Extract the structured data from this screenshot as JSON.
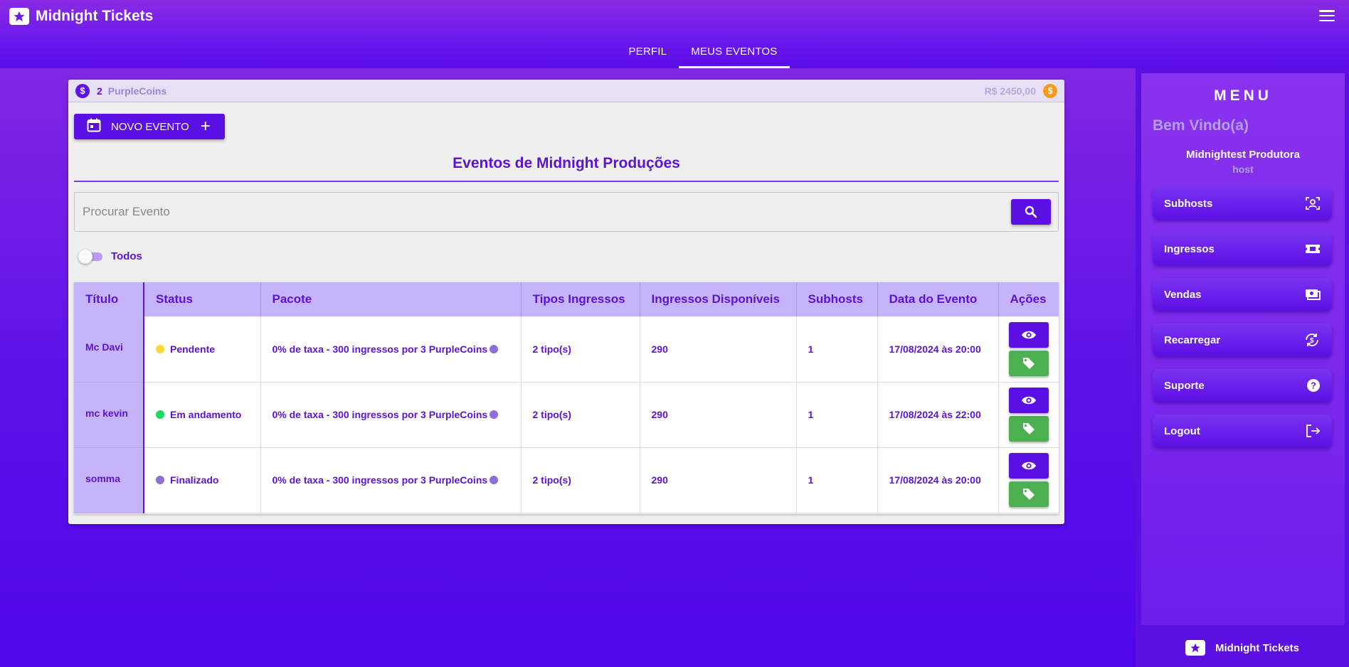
{
  "app": {
    "title": "Midnight Tickets"
  },
  "tabs": [
    {
      "label": "PERFIL",
      "active": false
    },
    {
      "label": "MEUS EVENTOS",
      "active": true
    }
  ],
  "coins": {
    "count": "2",
    "label": "PurpleCoins",
    "balance": "R$ 2450,00"
  },
  "toolbar": {
    "new_event_label": "NOVO EVENTO"
  },
  "page": {
    "title": "Eventos de Midnight Produções"
  },
  "search": {
    "placeholder": "Procurar Evento",
    "value": ""
  },
  "filter": {
    "toggle_label": "Todos",
    "toggle_on": false
  },
  "table": {
    "headers": [
      "Título",
      "Status",
      "Pacote",
      "Tipos Ingressos",
      "Ingressos Disponíveis",
      "Subhosts",
      "Data do Evento",
      "Ações"
    ],
    "rows": [
      {
        "title": "Mc Davi",
        "status": "Pendente",
        "status_color": "#fdd835",
        "package": "0% de taxa - 300 ingressos por 3 PurpleCoins",
        "ticket_types": "2 tipo(s)",
        "available": "290",
        "subhosts": "1",
        "date": "17/08/2024 às 20:00"
      },
      {
        "title": "mc kevin",
        "status": "Em andamento",
        "status_color": "#1ed760",
        "package": "0% de taxa - 300 ingressos por 3 PurpleCoins",
        "ticket_types": "2 tipo(s)",
        "available": "290",
        "subhosts": "1",
        "date": "17/08/2024 às 22:00"
      },
      {
        "title": "somma",
        "status": "Finalizado",
        "status_color": "#8e6fd8",
        "package": "0% de taxa - 300 ingressos por 3 PurpleCoins",
        "ticket_types": "2 tipo(s)",
        "available": "290",
        "subhosts": "1",
        "date": "17/08/2024 às 20:00"
      }
    ]
  },
  "sidebar": {
    "menu_title": "MENU",
    "welcome": "Bem Vindo(a)",
    "user_name": "Midnightest Produtora",
    "user_role": "host",
    "items": [
      {
        "label": "Subhosts",
        "icon": "user-scan-icon"
      },
      {
        "label": "Ingressos",
        "icon": "ticket-icon"
      },
      {
        "label": "Vendas",
        "icon": "money-icon"
      },
      {
        "label": "Recarregar",
        "icon": "reload-dollar-icon"
      },
      {
        "label": "Suporte",
        "icon": "help-icon"
      },
      {
        "label": "Logout",
        "icon": "logout-icon"
      }
    ],
    "footer_title": "Midnight Tickets"
  },
  "colors": {
    "primary": "#5c0fe3",
    "accent_purple": "#c6b4fb",
    "success": "#4caf50",
    "coin_orange": "#f59a1b"
  }
}
